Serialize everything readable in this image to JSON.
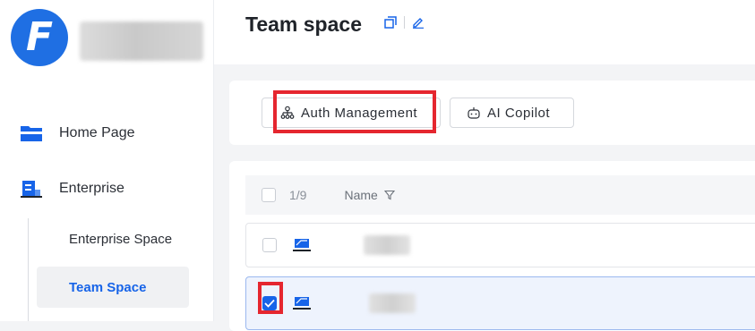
{
  "sidebar": {
    "logo_letter": "F",
    "nav": [
      {
        "label": "Home Page",
        "icon": "folder-icon"
      },
      {
        "label": "Enterprise",
        "icon": "building-icon"
      }
    ],
    "sub_items": [
      {
        "label": "Enterprise Space",
        "selected": false
      },
      {
        "label": "Team Space",
        "selected": true
      }
    ]
  },
  "header": {
    "title": "Team space",
    "icons": [
      "copy-icon",
      "edit-icon"
    ]
  },
  "toolbar": {
    "auth_label": "Auth Management",
    "ai_label": "AI Copilot"
  },
  "table": {
    "selection_count": "1/9",
    "name_header": "Name",
    "rows": [
      {
        "checked": false,
        "icon": "space-icon"
      },
      {
        "checked": true,
        "icon": "space-icon"
      }
    ]
  },
  "colors": {
    "accent": "#1764e8",
    "highlight": "#e5262f"
  }
}
